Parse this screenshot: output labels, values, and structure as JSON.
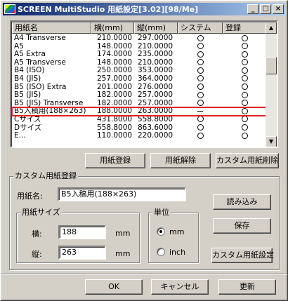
{
  "window": {
    "title": "SCREEN MultiStudio 用紙設定[3.02][98/Me]",
    "min_glyph": "_",
    "max_glyph": "□",
    "close_glyph": "×"
  },
  "list": {
    "columns": [
      "用紙名",
      "横(mm)",
      "縦(mm)",
      "システム",
      "登録"
    ],
    "rows": [
      {
        "name": "A4 Transverse",
        "w": "210.0000",
        "h": "297.0000",
        "sys": "circle",
        "reg": "circle"
      },
      {
        "name": "A5",
        "w": "148.0000",
        "h": "210.0000",
        "sys": "circle",
        "reg": "circle"
      },
      {
        "name": "A5 Extra",
        "w": "174.0000",
        "h": "235.0000",
        "sys": "circle",
        "reg": "circle"
      },
      {
        "name": "A5 Transverse",
        "w": "148.0000",
        "h": "210.0000",
        "sys": "circle",
        "reg": "circle"
      },
      {
        "name": "B4 (ISO)",
        "w": "250.0000",
        "h": "353.0000",
        "sys": "circle",
        "reg": "circle"
      },
      {
        "name": "B4 (JIS)",
        "w": "257.0000",
        "h": "364.0000",
        "sys": "circle",
        "reg": "circle"
      },
      {
        "name": "B5 (ISO) Extra",
        "w": "201.0000",
        "h": "276.0000",
        "sys": "circle",
        "reg": "circle"
      },
      {
        "name": "B5 (JIS)",
        "w": "182.0000",
        "h": "257.0000",
        "sys": "circle",
        "reg": "circle"
      },
      {
        "name": "B5 (JIS) Transverse",
        "w": "182.0000",
        "h": "257.0000",
        "sys": "circle",
        "reg": "circle"
      },
      {
        "name": "B5入稿用(188×263)",
        "w": "188.0000",
        "h": "263.0000",
        "sys": "dash",
        "reg": "circle",
        "selected": true
      },
      {
        "name": "Cサイズ",
        "w": "431.8000",
        "h": "558.8000",
        "sys": "circle",
        "reg": "circle"
      },
      {
        "name": "Dサイズ",
        "w": "558.8000",
        "h": "863.6000",
        "sys": "circle",
        "reg": "circle"
      },
      {
        "name": "E...",
        "w": "110.0000",
        "h": "220.0000",
        "sys": "circle",
        "reg": "circle"
      }
    ]
  },
  "buttons": {
    "register": "用紙登録",
    "unregister": "用紙解除",
    "delete_custom": "カスタム用紙削除",
    "load": "読み込み",
    "save": "保存",
    "custom_settings": "カスタム用紙設定",
    "ok": "OK",
    "cancel": "キャンセル",
    "refresh": "更新"
  },
  "custom": {
    "group_label": "カスタム用紙登録",
    "name_label": "用紙名:",
    "name_value": "B5入稿用(188×263)",
    "size_group_label": "用紙サイズ",
    "width_label": "横:",
    "width_value": "188",
    "height_label": "縦:",
    "height_value": "263",
    "unit_mm": "mm",
    "unit_group_label": "単位",
    "radio_mm": "mm",
    "radio_inch": "inch",
    "selected_unit": "mm"
  },
  "colors": {
    "title_start": "#0a246a",
    "title_end": "#a6caf0",
    "highlight": "#e02020"
  }
}
